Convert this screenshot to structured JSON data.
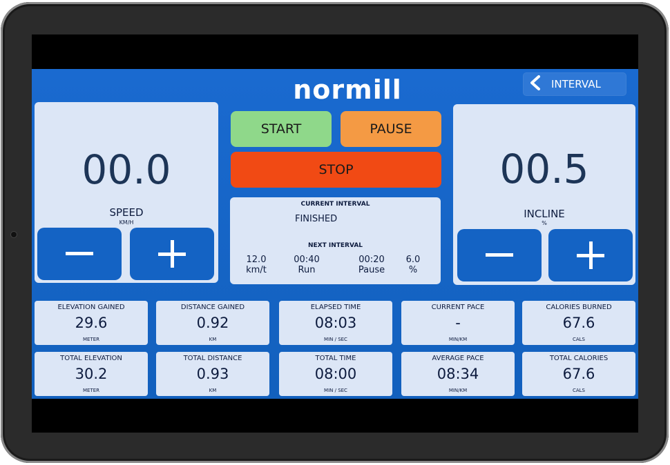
{
  "header": {
    "logo": "normill",
    "back_label": "INTERVAL"
  },
  "speed": {
    "value": "00.0",
    "label": "SPEED",
    "unit": "KM/H"
  },
  "incline": {
    "value": "00.5",
    "label": "INCLINE",
    "unit": "%"
  },
  "controls": {
    "start": "START",
    "pause": "PAUSE",
    "stop": "STOP"
  },
  "colors": {
    "start": "#8fd88a",
    "pause": "#f49a44",
    "stop": "#f14a14",
    "screen": "#1564bf"
  },
  "interval": {
    "current_title": "CURRENT INTERVAL",
    "current_status": "FINISHED",
    "next_title": "NEXT INTERVAL",
    "next": [
      {
        "value": "12.0",
        "label": "km/t"
      },
      {
        "value": "00:40",
        "label": "Run"
      },
      {
        "value": "00:20",
        "label": "Pause"
      },
      {
        "value": "6.0",
        "label": "%"
      }
    ]
  },
  "stats_row1": [
    {
      "title": "ELEVATION GAINED",
      "value": "29.6",
      "unit": "METER"
    },
    {
      "title": "DISTANCE GAINED",
      "value": "0.92",
      "unit": "KM"
    },
    {
      "title": "ELAPSED TIME",
      "value": "08:03",
      "unit": "MIN / SEC"
    },
    {
      "title": "CURRENT PACE",
      "value": "-",
      "unit": "MIN/KM"
    },
    {
      "title": "CALORIES BURNED",
      "value": "67.6",
      "unit": "CALS"
    }
  ],
  "stats_row2": [
    {
      "title": "TOTAL ELEVATION",
      "value": "30.2",
      "unit": "METER"
    },
    {
      "title": "TOTAL DISTANCE",
      "value": "0.93",
      "unit": "KM"
    },
    {
      "title": "TOTAL TIME",
      "value": "08:00",
      "unit": "MIN / SEC"
    },
    {
      "title": "AVERAGE PACE",
      "value": "08:34",
      "unit": "MIN/KM"
    },
    {
      "title": "TOTAL CALORIES",
      "value": "67.6",
      "unit": "CALS"
    }
  ]
}
